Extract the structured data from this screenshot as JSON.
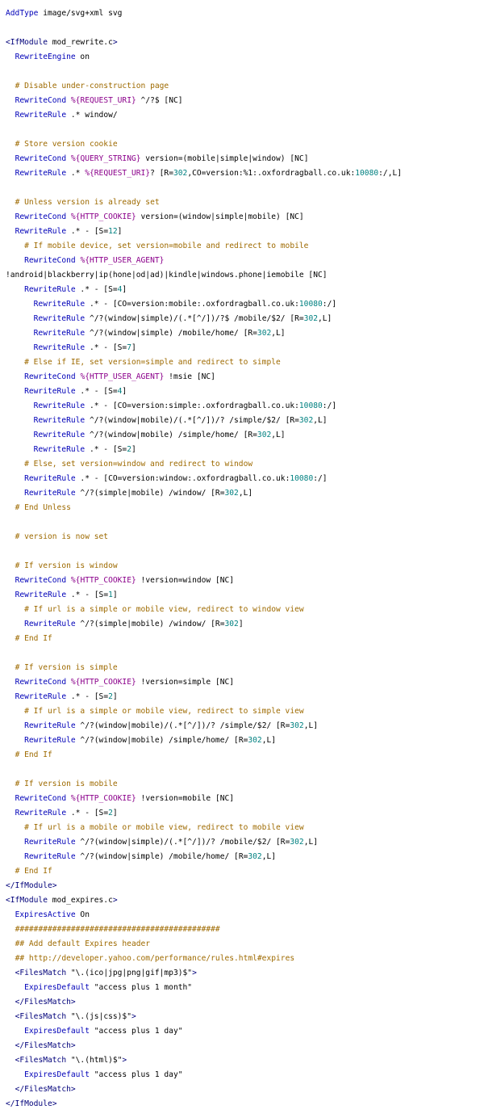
{
  "lines": [
    [
      {
        "t": "AddType",
        "c": "kw"
      },
      {
        "t": " image/svg+xml svg"
      }
    ],
    [],
    [
      {
        "t": "<IfModule",
        "c": "tag"
      },
      {
        "t": " mod_rewrite.c"
      },
      {
        "t": ">",
        "c": "tag"
      }
    ],
    [
      {
        "t": "  "
      },
      {
        "t": "RewriteEngine",
        "c": "kw"
      },
      {
        "t": " on"
      }
    ],
    [],
    [
      {
        "t": "  "
      },
      {
        "t": "# Disable under-construction page",
        "c": "cm"
      }
    ],
    [
      {
        "t": "  "
      },
      {
        "t": "RewriteCond",
        "c": "kw"
      },
      {
        "t": " "
      },
      {
        "t": "%{REQUEST_URI}",
        "c": "var"
      },
      {
        "t": " ^/?$ [NC]"
      }
    ],
    [
      {
        "t": "  "
      },
      {
        "t": "RewriteRule",
        "c": "kw"
      },
      {
        "t": " .* window/"
      }
    ],
    [],
    [
      {
        "t": "  "
      },
      {
        "t": "# Store version cookie",
        "c": "cm"
      }
    ],
    [
      {
        "t": "  "
      },
      {
        "t": "RewriteCond",
        "c": "kw"
      },
      {
        "t": " "
      },
      {
        "t": "%{QUERY_STRING}",
        "c": "var"
      },
      {
        "t": " version=(mobile|simple|window) [NC]"
      }
    ],
    [
      {
        "t": "  "
      },
      {
        "t": "RewriteRule",
        "c": "kw"
      },
      {
        "t": " .* "
      },
      {
        "t": "%{REQUEST_URI}",
        "c": "var"
      },
      {
        "t": "? [R="
      },
      {
        "t": "302",
        "c": "num"
      },
      {
        "t": ",CO=version:%1:.oxfordragball.co.uk:"
      },
      {
        "t": "10080",
        "c": "num"
      },
      {
        "t": ":/,L]"
      }
    ],
    [],
    [
      {
        "t": "  "
      },
      {
        "t": "# Unless version is already set",
        "c": "cm"
      }
    ],
    [
      {
        "t": "  "
      },
      {
        "t": "RewriteCond",
        "c": "kw"
      },
      {
        "t": " "
      },
      {
        "t": "%{HTTP_COOKIE}",
        "c": "var"
      },
      {
        "t": " version=(window|simple|mobile) [NC]"
      }
    ],
    [
      {
        "t": "  "
      },
      {
        "t": "RewriteRule",
        "c": "kw"
      },
      {
        "t": " .* - [S="
      },
      {
        "t": "12",
        "c": "num"
      },
      {
        "t": "]"
      }
    ],
    [
      {
        "t": "    "
      },
      {
        "t": "# If mobile device, set version=mobile and redirect to mobile",
        "c": "cm"
      }
    ],
    [
      {
        "t": "    "
      },
      {
        "t": "RewriteCond",
        "c": "kw"
      },
      {
        "t": " "
      },
      {
        "t": "%{HTTP_USER_AGENT}",
        "c": "var"
      }
    ],
    [
      {
        "t": "!android|blackberry|ip(hone|od|ad)|kindle|windows.phone|iemobile [NC]"
      }
    ],
    [
      {
        "t": "    "
      },
      {
        "t": "RewriteRule",
        "c": "kw"
      },
      {
        "t": " .* - [S="
      },
      {
        "t": "4",
        "c": "num"
      },
      {
        "t": "]"
      }
    ],
    [
      {
        "t": "      "
      },
      {
        "t": "RewriteRule",
        "c": "kw"
      },
      {
        "t": " .* - [CO=version:mobile:.oxfordragball.co.uk:"
      },
      {
        "t": "10080",
        "c": "num"
      },
      {
        "t": ":/]"
      }
    ],
    [
      {
        "t": "      "
      },
      {
        "t": "RewriteRule",
        "c": "kw"
      },
      {
        "t": " ^/?(window|simple)/(.*[^/])/?$ /mobile/$2/ [R="
      },
      {
        "t": "302",
        "c": "num"
      },
      {
        "t": ",L]"
      }
    ],
    [
      {
        "t": "      "
      },
      {
        "t": "RewriteRule",
        "c": "kw"
      },
      {
        "t": " ^/?(window|simple) /mobile/home/ [R="
      },
      {
        "t": "302",
        "c": "num"
      },
      {
        "t": ",L]"
      }
    ],
    [
      {
        "t": "      "
      },
      {
        "t": "RewriteRule",
        "c": "kw"
      },
      {
        "t": " .* - [S="
      },
      {
        "t": "7",
        "c": "num"
      },
      {
        "t": "]"
      }
    ],
    [
      {
        "t": "    "
      },
      {
        "t": "# Else if IE, set version=simple and redirect to simple",
        "c": "cm"
      }
    ],
    [
      {
        "t": "    "
      },
      {
        "t": "RewriteCond",
        "c": "kw"
      },
      {
        "t": " "
      },
      {
        "t": "%{HTTP_USER_AGENT}",
        "c": "var"
      },
      {
        "t": " !msie [NC]"
      }
    ],
    [
      {
        "t": "    "
      },
      {
        "t": "RewriteRule",
        "c": "kw"
      },
      {
        "t": " .* - [S="
      },
      {
        "t": "4",
        "c": "num"
      },
      {
        "t": "]"
      }
    ],
    [
      {
        "t": "      "
      },
      {
        "t": "RewriteRule",
        "c": "kw"
      },
      {
        "t": " .* - [CO=version:simple:.oxfordragball.co.uk:"
      },
      {
        "t": "10080",
        "c": "num"
      },
      {
        "t": ":/]"
      }
    ],
    [
      {
        "t": "      "
      },
      {
        "t": "RewriteRule",
        "c": "kw"
      },
      {
        "t": " ^/?(window|mobile)/(.*[^/])/? /simple/$2/ [R="
      },
      {
        "t": "302",
        "c": "num"
      },
      {
        "t": ",L]"
      }
    ],
    [
      {
        "t": "      "
      },
      {
        "t": "RewriteRule",
        "c": "kw"
      },
      {
        "t": " ^/?(window|mobile) /simple/home/ [R="
      },
      {
        "t": "302",
        "c": "num"
      },
      {
        "t": ",L]"
      }
    ],
    [
      {
        "t": "      "
      },
      {
        "t": "RewriteRule",
        "c": "kw"
      },
      {
        "t": " .* - [S="
      },
      {
        "t": "2",
        "c": "num"
      },
      {
        "t": "]"
      }
    ],
    [
      {
        "t": "    "
      },
      {
        "t": "# Else, set version=window and redirect to window",
        "c": "cm"
      }
    ],
    [
      {
        "t": "    "
      },
      {
        "t": "RewriteRule",
        "c": "kw"
      },
      {
        "t": " .* - [CO=version:window:.oxfordragball.co.uk:"
      },
      {
        "t": "10080",
        "c": "num"
      },
      {
        "t": ":/]"
      }
    ],
    [
      {
        "t": "    "
      },
      {
        "t": "RewriteRule",
        "c": "kw"
      },
      {
        "t": " ^/?(simple|mobile) /window/ [R="
      },
      {
        "t": "302",
        "c": "num"
      },
      {
        "t": ",L]"
      }
    ],
    [
      {
        "t": "  "
      },
      {
        "t": "# End Unless",
        "c": "cm"
      }
    ],
    [],
    [
      {
        "t": "  "
      },
      {
        "t": "# version is now set",
        "c": "cm"
      }
    ],
    [],
    [
      {
        "t": "  "
      },
      {
        "t": "# If version is window",
        "c": "cm"
      }
    ],
    [
      {
        "t": "  "
      },
      {
        "t": "RewriteCond",
        "c": "kw"
      },
      {
        "t": " "
      },
      {
        "t": "%{HTTP_COOKIE}",
        "c": "var"
      },
      {
        "t": " !version=window [NC]"
      }
    ],
    [
      {
        "t": "  "
      },
      {
        "t": "RewriteRule",
        "c": "kw"
      },
      {
        "t": " .* - [S="
      },
      {
        "t": "1",
        "c": "num"
      },
      {
        "t": "]"
      }
    ],
    [
      {
        "t": "    "
      },
      {
        "t": "# If url is a simple or mobile view, redirect to window view",
        "c": "cm"
      }
    ],
    [
      {
        "t": "    "
      },
      {
        "t": "RewriteRule",
        "c": "kw"
      },
      {
        "t": " ^/?(simple|mobile) /window/ [R="
      },
      {
        "t": "302",
        "c": "num"
      },
      {
        "t": "]"
      }
    ],
    [
      {
        "t": "  "
      },
      {
        "t": "# End If",
        "c": "cm"
      }
    ],
    [],
    [
      {
        "t": "  "
      },
      {
        "t": "# If version is simple",
        "c": "cm"
      }
    ],
    [
      {
        "t": "  "
      },
      {
        "t": "RewriteCond",
        "c": "kw"
      },
      {
        "t": " "
      },
      {
        "t": "%{HTTP_COOKIE}",
        "c": "var"
      },
      {
        "t": " !version=simple [NC]"
      }
    ],
    [
      {
        "t": "  "
      },
      {
        "t": "RewriteRule",
        "c": "kw"
      },
      {
        "t": " .* - [S="
      },
      {
        "t": "2",
        "c": "num"
      },
      {
        "t": "]"
      }
    ],
    [
      {
        "t": "    "
      },
      {
        "t": "# If url is a simple or mobile view, redirect to simple view",
        "c": "cm"
      }
    ],
    [
      {
        "t": "    "
      },
      {
        "t": "RewriteRule",
        "c": "kw"
      },
      {
        "t": " ^/?(window|mobile)/(.*[^/])/? /simple/$2/ [R="
      },
      {
        "t": "302",
        "c": "num"
      },
      {
        "t": ",L]"
      }
    ],
    [
      {
        "t": "    "
      },
      {
        "t": "RewriteRule",
        "c": "kw"
      },
      {
        "t": " ^/?(window|mobile) /simple/home/ [R="
      },
      {
        "t": "302",
        "c": "num"
      },
      {
        "t": ",L]"
      }
    ],
    [
      {
        "t": "  "
      },
      {
        "t": "# End If",
        "c": "cm"
      }
    ],
    [],
    [
      {
        "t": "  "
      },
      {
        "t": "# If version is mobile",
        "c": "cm"
      }
    ],
    [
      {
        "t": "  "
      },
      {
        "t": "RewriteCond",
        "c": "kw"
      },
      {
        "t": " "
      },
      {
        "t": "%{HTTP_COOKIE}",
        "c": "var"
      },
      {
        "t": " !version=mobile [NC]"
      }
    ],
    [
      {
        "t": "  "
      },
      {
        "t": "RewriteRule",
        "c": "kw"
      },
      {
        "t": " .* - [S="
      },
      {
        "t": "2",
        "c": "num"
      },
      {
        "t": "]"
      }
    ],
    [
      {
        "t": "    "
      },
      {
        "t": "# If url is a mobile or mobile view, redirect to mobile view",
        "c": "cm"
      }
    ],
    [
      {
        "t": "    "
      },
      {
        "t": "RewriteRule",
        "c": "kw"
      },
      {
        "t": " ^/?(window|simple)/(.*[^/])/? /mobile/$2/ [R="
      },
      {
        "t": "302",
        "c": "num"
      },
      {
        "t": ",L]"
      }
    ],
    [
      {
        "t": "    "
      },
      {
        "t": "RewriteRule",
        "c": "kw"
      },
      {
        "t": " ^/?(window|simple) /mobile/home/ [R="
      },
      {
        "t": "302",
        "c": "num"
      },
      {
        "t": ",L]"
      }
    ],
    [
      {
        "t": "  "
      },
      {
        "t": "# End If",
        "c": "cm"
      }
    ],
    [
      {
        "t": "</IfModule>",
        "c": "tag"
      }
    ],
    [
      {
        "t": "<IfModule",
        "c": "tag"
      },
      {
        "t": " mod_expires.c"
      },
      {
        "t": ">",
        "c": "tag"
      }
    ],
    [
      {
        "t": "  "
      },
      {
        "t": "ExpiresActive",
        "c": "kw"
      },
      {
        "t": " On"
      }
    ],
    [
      {
        "t": "  "
      },
      {
        "t": "############################################",
        "c": "cm"
      }
    ],
    [
      {
        "t": "  "
      },
      {
        "t": "## Add default Expires header",
        "c": "cm"
      }
    ],
    [
      {
        "t": "  "
      },
      {
        "t": "## http://developer.yahoo.com/performance/rules.html#expires",
        "c": "cm"
      }
    ],
    [
      {
        "t": "  "
      },
      {
        "t": "<FilesMatch",
        "c": "tag"
      },
      {
        "t": " \"\\.(ico|jpg|png|gif|mp3)$\""
      },
      {
        "t": ">",
        "c": "tag"
      }
    ],
    [
      {
        "t": "    "
      },
      {
        "t": "ExpiresDefault",
        "c": "kw"
      },
      {
        "t": " \"access plus 1 month\""
      }
    ],
    [
      {
        "t": "  "
      },
      {
        "t": "</FilesMatch>",
        "c": "tag"
      }
    ],
    [
      {
        "t": "  "
      },
      {
        "t": "<FilesMatch",
        "c": "tag"
      },
      {
        "t": " \"\\.(js|css)$\""
      },
      {
        "t": ">",
        "c": "tag"
      }
    ],
    [
      {
        "t": "    "
      },
      {
        "t": "ExpiresDefault",
        "c": "kw"
      },
      {
        "t": " \"access plus 1 day\""
      }
    ],
    [
      {
        "t": "  "
      },
      {
        "t": "</FilesMatch>",
        "c": "tag"
      }
    ],
    [
      {
        "t": "  "
      },
      {
        "t": "<FilesMatch",
        "c": "tag"
      },
      {
        "t": " \"\\.(html)$\""
      },
      {
        "t": ">",
        "c": "tag"
      }
    ],
    [
      {
        "t": "    "
      },
      {
        "t": "ExpiresDefault",
        "c": "kw"
      },
      {
        "t": " \"access plus 1 day\""
      }
    ],
    [
      {
        "t": "  "
      },
      {
        "t": "</FilesMatch>",
        "c": "tag"
      }
    ],
    [
      {
        "t": "</IfModule>",
        "c": "tag"
      }
    ]
  ]
}
